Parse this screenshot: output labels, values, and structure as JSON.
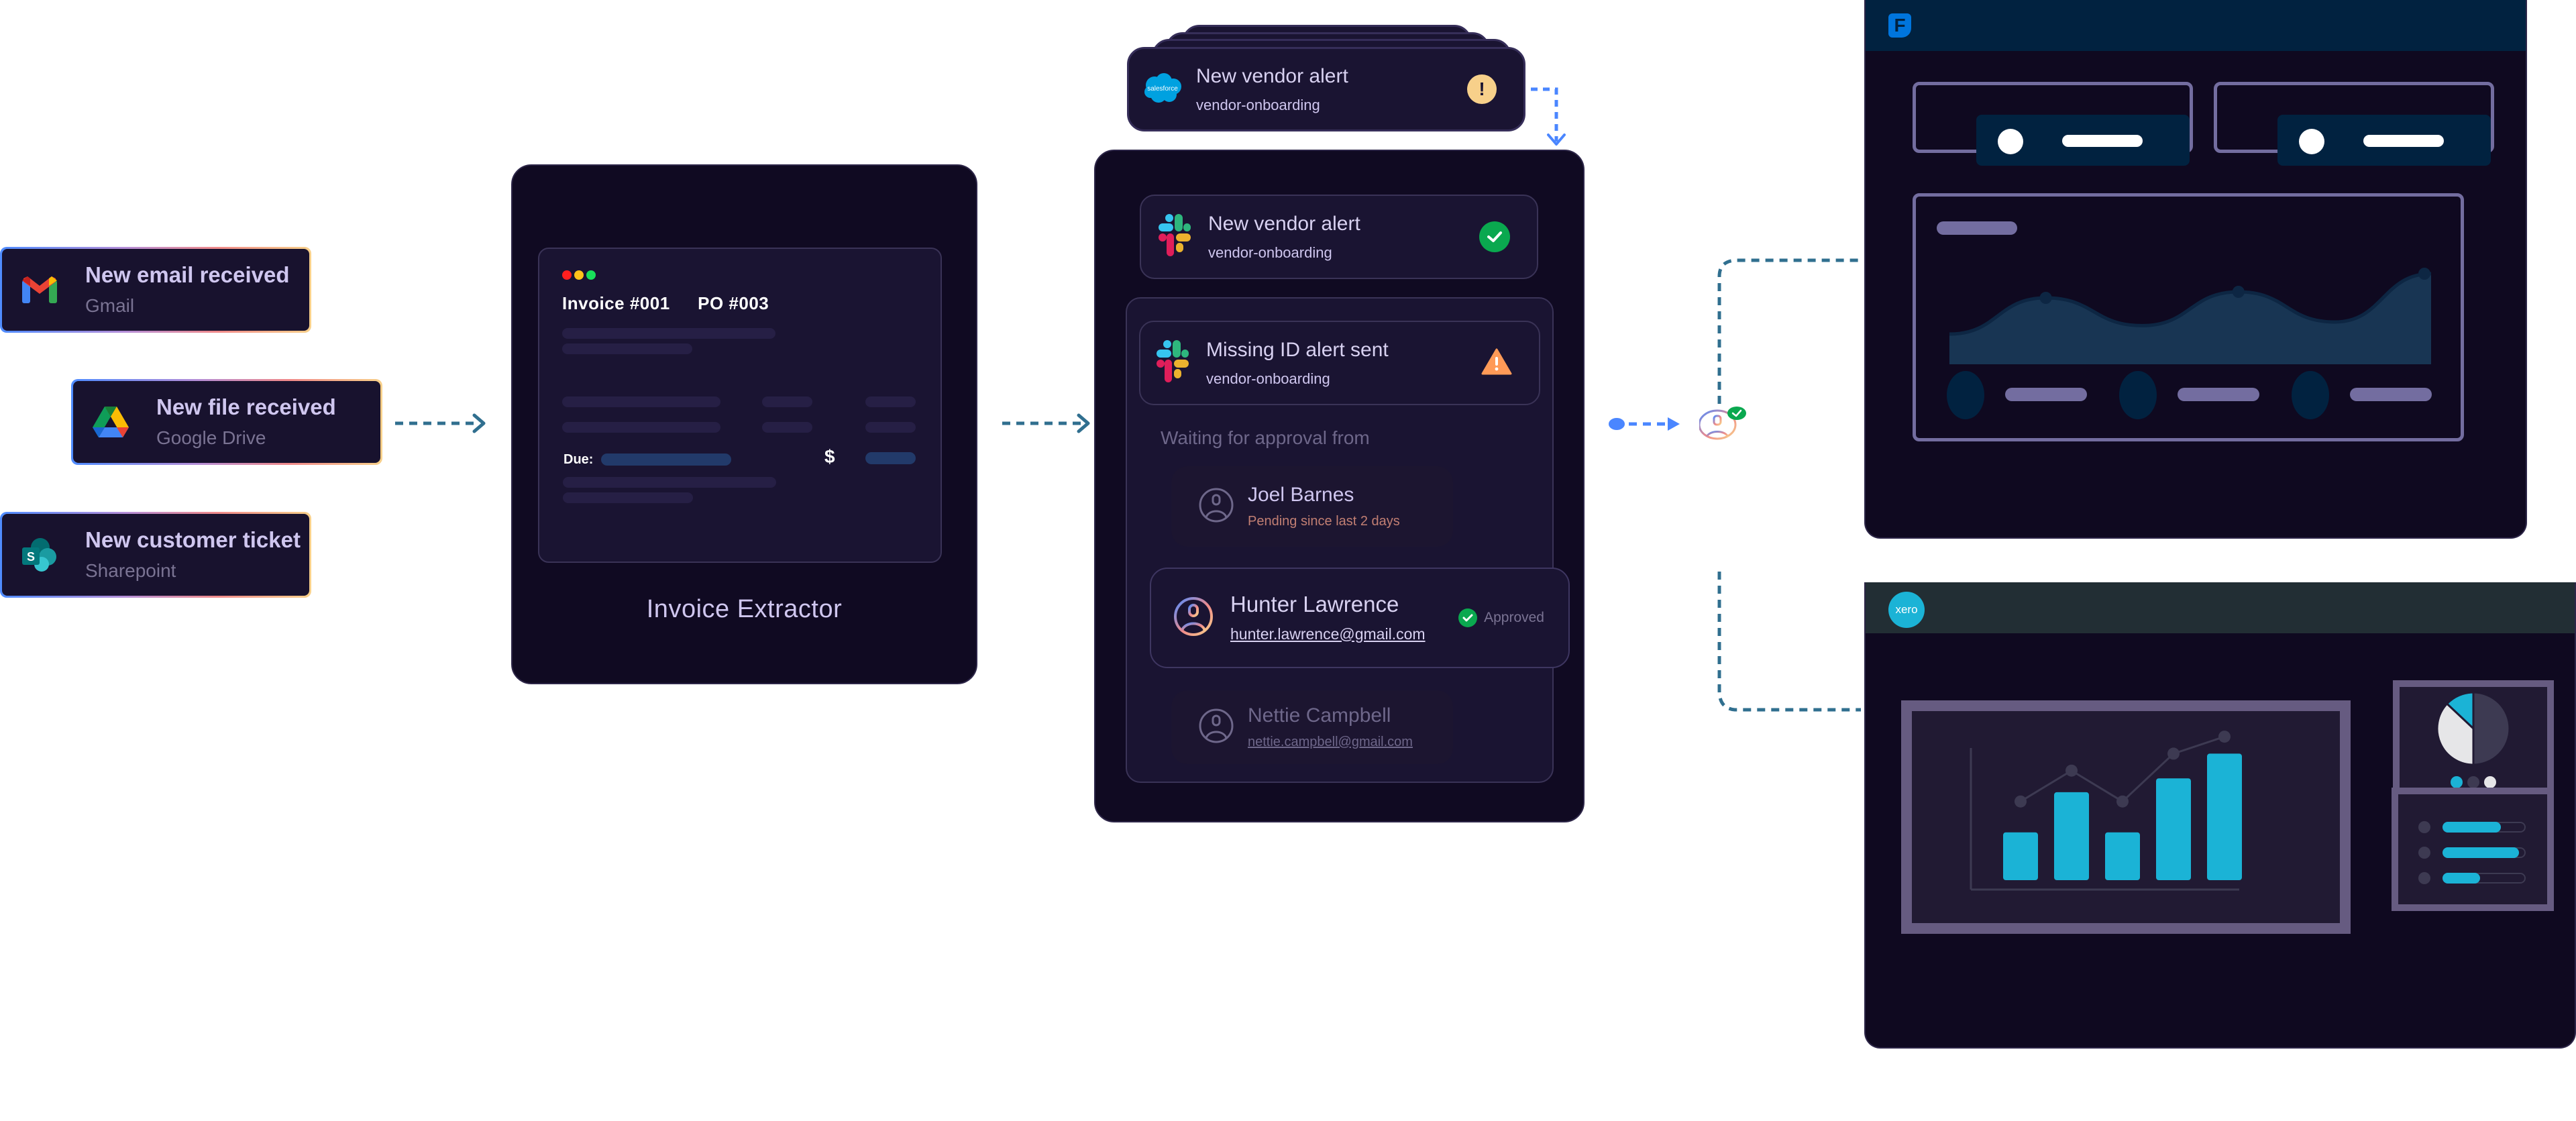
{
  "triggers": [
    {
      "title": "New email received",
      "source": "Gmail",
      "icon": "gmail-icon"
    },
    {
      "title": "New file received",
      "source": "Google Drive",
      "icon": "google-drive-icon"
    },
    {
      "title": "New customer ticket",
      "source": "Sharepoint",
      "icon": "sharepoint-icon"
    }
  ],
  "invoice_extractor": {
    "label": "Invoice Extractor",
    "document": {
      "invoice_number": "Invoice #001",
      "po_number": "PO #003",
      "due_label": "Due:",
      "currency_symbol": "$"
    },
    "window_dots": [
      "#ff1f1f",
      "#ffc21a",
      "#18e05a"
    ]
  },
  "salesforce_alert": {
    "title": "New vendor alert",
    "channel": "vendor-onboarding",
    "source_icon": "salesforce-icon",
    "source_label": "salesforce",
    "status": "warning",
    "status_icon": "exclamation-circle-icon"
  },
  "workflow": {
    "notifications": [
      {
        "title": "New vendor alert",
        "channel": "vendor-onboarding",
        "source_icon": "slack-icon",
        "status": "success",
        "status_icon": "check-circle-icon"
      },
      {
        "title": "Missing ID alert sent",
        "channel": "vendor-onboarding",
        "source_icon": "slack-icon",
        "status": "warning",
        "status_icon": "warning-triangle-icon"
      }
    ],
    "approval": {
      "heading": "Waiting for approval from",
      "approvers": [
        {
          "name": "Joel Barnes",
          "detail": "Pending since last 2 days",
          "state": "pending"
        },
        {
          "name": "Hunter Lawrence",
          "detail": "hunter.lawrence@gmail.com",
          "state": "approved",
          "badge": "Approved"
        },
        {
          "name": "Nettie Campbell",
          "detail": "nettie.campbell@gmail.com",
          "state": "inactive"
        }
      ]
    }
  },
  "approved_node": {
    "icon": "user-approved-icon"
  },
  "freshbooks": {
    "logo": "F",
    "logo_icon": "freshbooks-icon",
    "area_chart_points": [
      0.25,
      0.55,
      0.32,
      0.6,
      0.35,
      0.75
    ]
  },
  "xero": {
    "logo": "xero",
    "logo_icon": "xero-icon",
    "bar_values": [
      0.31,
      0.57,
      0.31,
      0.66,
      0.82
    ],
    "line_values": [
      0.51,
      0.71,
      0.51,
      0.82,
      0.93
    ],
    "pie_shares": [
      0.13,
      0.5,
      0.37
    ],
    "pie_colors": [
      "#1bb3d6",
      "#3d3a52",
      "#e6e6e8"
    ],
    "progress": [
      0.7,
      0.92,
      0.45
    ]
  },
  "colors": {
    "canvas": "#ffffff",
    "panel": "#100a22",
    "card": "#1a1432",
    "text_primary": "#d8d1f1",
    "connector": "#306f8f",
    "connector_active": "#4a86ff",
    "success": "#0aa84f",
    "warning_yellow": "#f7d08a",
    "warning_orange": "#ff9a57",
    "pending_text": "#c27f73",
    "xero_blue": "#1bb3d6",
    "freshbooks_header": "#012240",
    "xero_header": "#222e34"
  }
}
